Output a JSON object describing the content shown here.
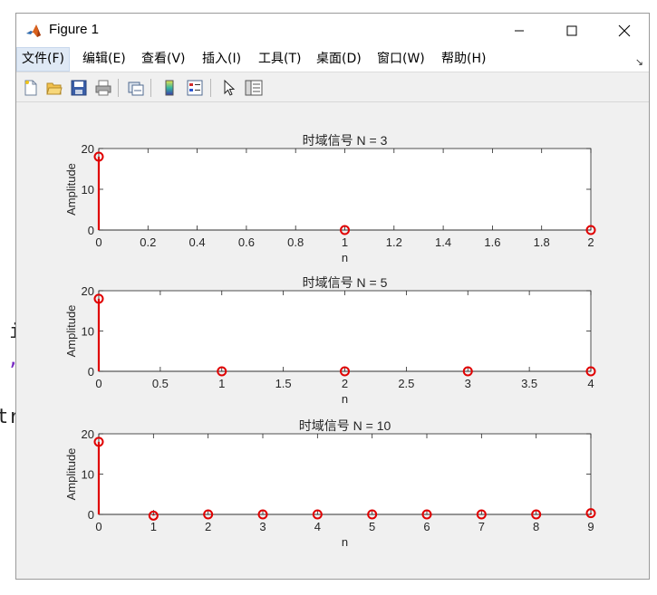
{
  "window": {
    "title": "Figure 1"
  },
  "menu": [
    {
      "label": "文件(F)"
    },
    {
      "label": "编辑(E)"
    },
    {
      "label": "查看(V)"
    },
    {
      "label": "插入(I)"
    },
    {
      "label": "工具(T)"
    },
    {
      "label": "桌面(D)"
    },
    {
      "label": "窗口(W)"
    },
    {
      "label": "帮助(H)"
    }
  ],
  "menu_overflow_arrow": "↘",
  "toolbar_icons": [
    "new-figure-icon",
    "open-file-icon",
    "save-icon",
    "print-icon",
    "link-plot-icon",
    "insert-colorbar-icon",
    "insert-legend-icon",
    "pointer-icon",
    "property-inspector-icon"
  ],
  "background_text": [
    {
      "text": "i",
      "color": "#222222"
    },
    {
      "text": ",",
      "color": "#7a2fc4"
    },
    {
      "text": "tr",
      "color": "#222222"
    }
  ],
  "colors": {
    "stem": "#e00000",
    "axis": "#262626",
    "plot_bg": "#ffffff",
    "figure_bg": "#f0f0f0"
  },
  "chart_data": [
    {
      "type": "stem",
      "title": "时域信号 N = 3",
      "xlabel": "n",
      "ylabel": "Amplitude",
      "x": [
        0,
        1,
        2
      ],
      "y": [
        18,
        0,
        0
      ],
      "xlim": [
        0,
        2
      ],
      "ylim": [
        0,
        20
      ],
      "xticks": [
        0,
        0.2,
        0.4,
        0.6,
        0.8,
        1,
        1.2,
        1.4,
        1.6,
        1.8,
        2
      ],
      "xticklabels": [
        "0",
        "0.2",
        "0.4",
        "0.6",
        "0.8",
        "1",
        "1.2",
        "1.4",
        "1.6",
        "1.8",
        "2"
      ],
      "yticks": [
        0,
        10,
        20
      ],
      "yticklabels": [
        "0",
        "10",
        "20"
      ]
    },
    {
      "type": "stem",
      "title": "时域信号 N = 5",
      "xlabel": "n",
      "ylabel": "Amplitude",
      "x": [
        0,
        1,
        2,
        3,
        4
      ],
      "y": [
        18,
        0,
        0,
        0,
        0
      ],
      "xlim": [
        0,
        4
      ],
      "ylim": [
        0,
        20
      ],
      "xticks": [
        0,
        0.5,
        1,
        1.5,
        2,
        2.5,
        3,
        3.5,
        4
      ],
      "xticklabels": [
        "0",
        "0.5",
        "1",
        "1.5",
        "2",
        "2.5",
        "3",
        "3.5",
        "4"
      ],
      "yticks": [
        0,
        10,
        20
      ],
      "yticklabels": [
        "0",
        "10",
        "20"
      ]
    },
    {
      "type": "stem",
      "title": "时域信号 N = 10",
      "xlabel": "n",
      "ylabel": "Amplitude",
      "x": [
        0,
        1,
        2,
        3,
        4,
        5,
        6,
        7,
        8,
        9
      ],
      "y": [
        18,
        -0.3,
        0,
        0,
        0,
        0,
        0,
        0,
        0,
        0.3
      ],
      "xlim": [
        0,
        9
      ],
      "ylim": [
        0,
        20
      ],
      "xticks": [
        0,
        1,
        2,
        3,
        4,
        5,
        6,
        7,
        8,
        9
      ],
      "xticklabels": [
        "0",
        "1",
        "2",
        "3",
        "4",
        "5",
        "6",
        "7",
        "8",
        "9"
      ],
      "yticks": [
        0,
        10,
        20
      ],
      "yticklabels": [
        "0",
        "10",
        "20"
      ]
    }
  ]
}
